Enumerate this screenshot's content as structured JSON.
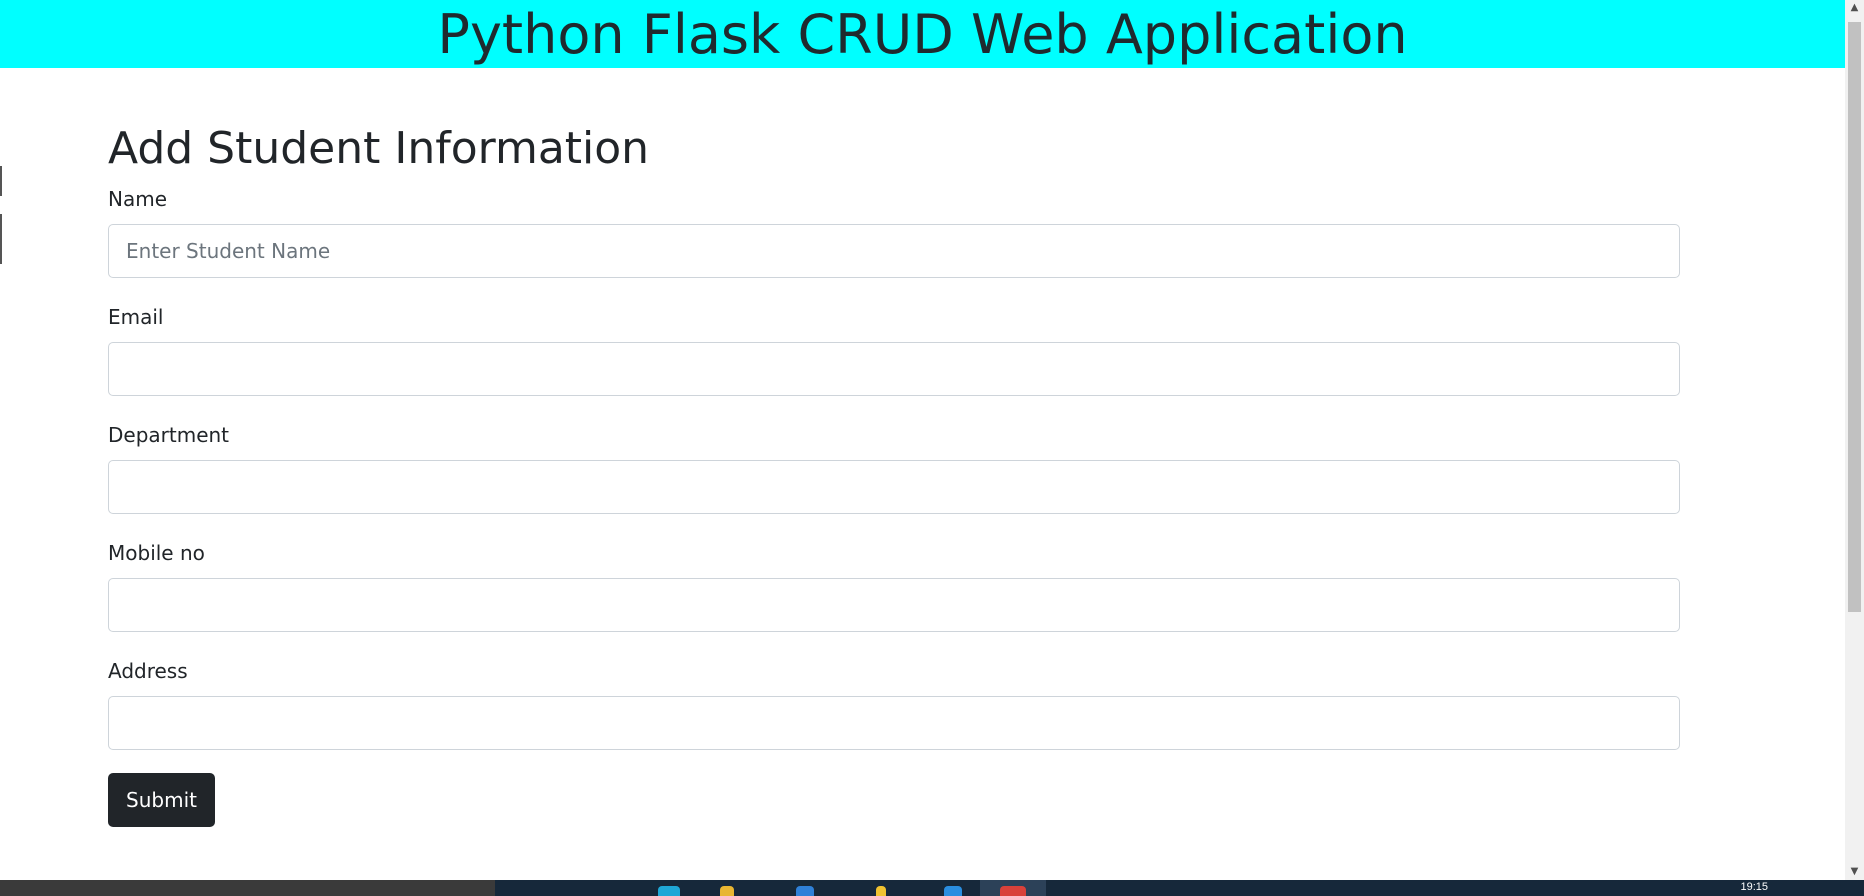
{
  "header": {
    "title": "Python Flask CRUD Web Application",
    "background": "#00ffff"
  },
  "form": {
    "title": "Add Student Information",
    "fields": [
      {
        "label": "Name",
        "placeholder": "Enter Student Name",
        "value": ""
      },
      {
        "label": "Email",
        "placeholder": "",
        "value": ""
      },
      {
        "label": "Department",
        "placeholder": "",
        "value": ""
      },
      {
        "label": "Mobile no",
        "placeholder": "",
        "value": ""
      },
      {
        "label": "Address",
        "placeholder": "",
        "value": ""
      }
    ],
    "submit_label": "Submit",
    "submit_color": "#212529"
  },
  "scrollbar": {
    "up_arrow_icon": "triangle-up",
    "down_arrow_icon": "triangle-down"
  },
  "taskbar": {
    "clock": "19:15",
    "icons": [
      "edge-icon",
      "file-explorer-icon",
      "vscode-icon",
      "folder-icon",
      "app-icon",
      "chrome-icon"
    ]
  }
}
